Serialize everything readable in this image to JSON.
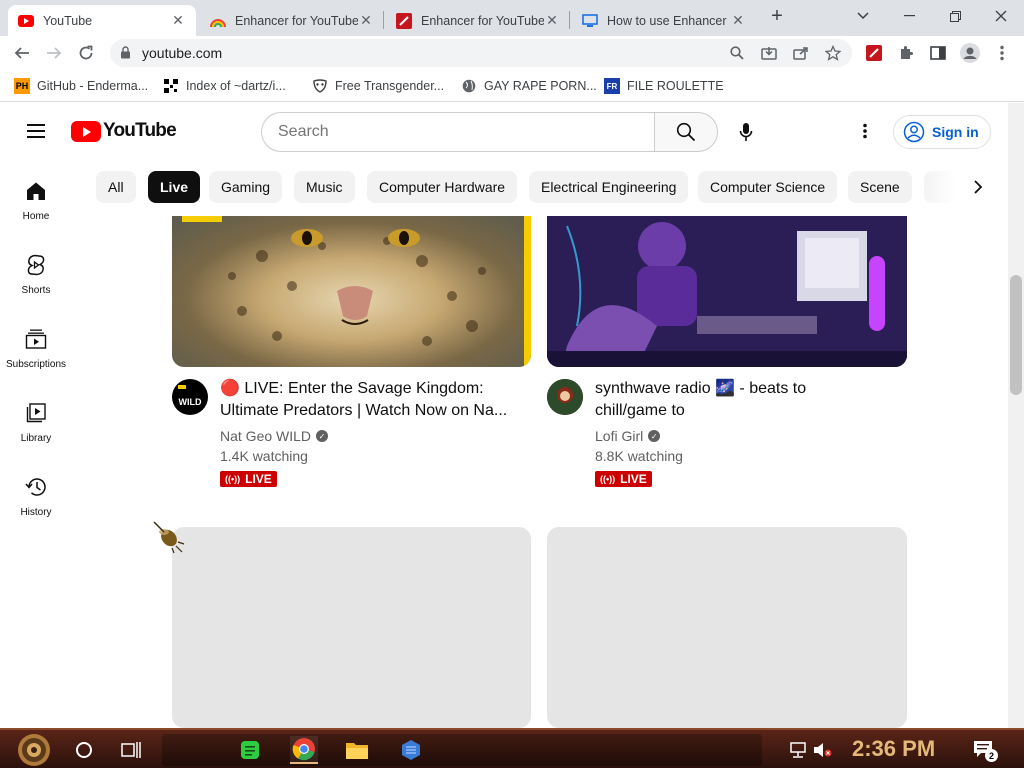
{
  "browser": {
    "tabs": [
      {
        "title": "YouTube",
        "active": true
      },
      {
        "title": "Enhancer for YouTube",
        "active": false
      },
      {
        "title": "Enhancer for YouTube",
        "active": false
      },
      {
        "title": "How to use Enhancer",
        "active": false
      }
    ],
    "url": "youtube.com"
  },
  "bookmarks": [
    {
      "label": "GitHub - Enderma...",
      "icon": "ph-icon",
      "icon_text": "PH"
    },
    {
      "label": "Index of ~dartz/i...",
      "icon": "qr-icon"
    },
    {
      "label": "Free Transgender...",
      "icon": "mask-icon"
    },
    {
      "label": "GAY RAPE PORN...",
      "icon": "globe-icon"
    },
    {
      "label": "FILE ROULETTE",
      "icon": "file-roulette-icon",
      "icon_text": "FR"
    }
  ],
  "header": {
    "logo": "YouTube",
    "search_placeholder": "Search",
    "signin": "Sign in"
  },
  "chips": [
    "All",
    "Live",
    "Gaming",
    "Music",
    "Computer Hardware",
    "Electrical Engineering",
    "Computer Science",
    "Scene"
  ],
  "selected_chip": "Live",
  "sidebar": [
    {
      "label": "Home",
      "icon": "home-icon"
    },
    {
      "label": "Shorts",
      "icon": "shorts-icon"
    },
    {
      "label": "Subscriptions",
      "icon": "subscriptions-icon"
    },
    {
      "label": "Library",
      "icon": "library-icon"
    },
    {
      "label": "History",
      "icon": "history-icon"
    }
  ],
  "videos": [
    {
      "title_line1": "🔴 LIVE: Enter the Savage Kingdom:",
      "title_line2": "Ultimate Predators | Watch Now on Na...",
      "channel": "Nat Geo WILD",
      "watching": "1.4K watching",
      "badge": "LIVE"
    },
    {
      "title_line1": "synthwave radio 🌌 - beats to",
      "title_line2": "chill/game to",
      "channel": "Lofi Girl",
      "watching": "8.8K watching",
      "badge": "LIVE"
    }
  ],
  "taskbar": {
    "clock": "2:36 PM",
    "notifications": "2"
  },
  "colors": {
    "youtube_red": "#ff0000",
    "live_red": "#cc0000",
    "signin_blue": "#065fd4",
    "taskbar": "#5a2417"
  }
}
